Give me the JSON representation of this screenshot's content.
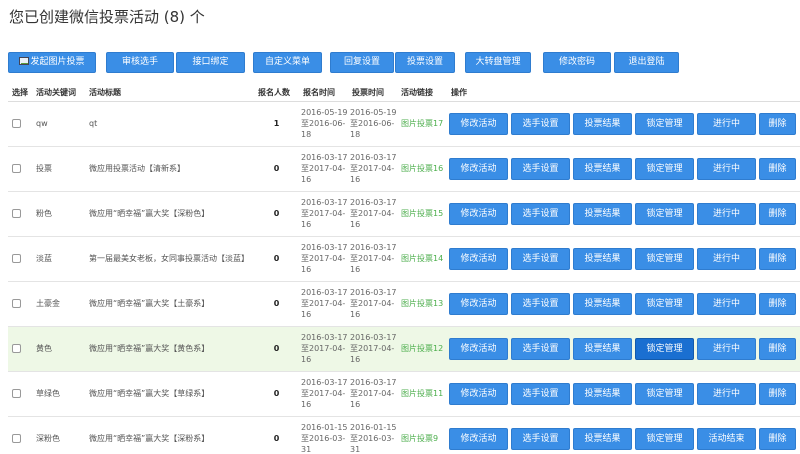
{
  "page": {
    "title": "您已创建微信投票活动 (8) 个"
  },
  "toolbar": {
    "buttons": [
      {
        "label": "发起图片投票",
        "icon": "picture-icon"
      },
      {
        "label": "审核选手"
      },
      {
        "label": "接口绑定"
      },
      {
        "label": "自定义菜单"
      },
      {
        "label": "回复设置"
      },
      {
        "label": "投票设置"
      },
      {
        "label": "大转盘管理"
      },
      {
        "label": "修改密码"
      },
      {
        "label": "退出登陆"
      }
    ]
  },
  "table": {
    "headers": [
      "选择",
      "活动关键词",
      "活动标题",
      "报名人数",
      "报名时间",
      "投票时间",
      "活动链接",
      "操作"
    ],
    "ops": {
      "edit": "修改活动",
      "contestants": "选手设置",
      "results": "投票结果",
      "lock": "锁定管理",
      "running": "进行中",
      "ended": "活动结束",
      "delete": "删除"
    },
    "rows": [
      {
        "keyword": "qw",
        "title": "qt",
        "count": "1",
        "signup": "2016-05-19至2016-06-18",
        "vote": "2016-05-19至2016-06-18",
        "link": "图片投票17",
        "status": "进行中"
      },
      {
        "keyword": "投票",
        "title": "微应用投票活动【清新系】",
        "count": "0",
        "signup": "2016-03-17至2017-04-16",
        "vote": "2016-03-17至2017-04-16",
        "link": "图片投票16",
        "status": "进行中"
      },
      {
        "keyword": "粉色",
        "title": "微应用“晒幸福”赢大奖【深粉色】",
        "count": "0",
        "signup": "2016-03-17至2017-04-16",
        "vote": "2016-03-17至2017-04-16",
        "link": "图片投票15",
        "status": "进行中"
      },
      {
        "keyword": "淡蓝",
        "title": "第一届最美女老板，女同事投票活动【淡蓝】",
        "count": "0",
        "signup": "2016-03-17至2017-04-16",
        "vote": "2016-03-17至2017-04-16",
        "link": "图片投票14",
        "status": "进行中"
      },
      {
        "keyword": "土豪金",
        "title": "微应用“晒幸福”赢大奖【土豪系】",
        "count": "0",
        "signup": "2016-03-17至2017-04-16",
        "vote": "2016-03-17至2017-04-16",
        "link": "图片投票13",
        "status": "进行中"
      },
      {
        "keyword": "黄色",
        "title": "微应用“晒幸福”赢大奖【黄色系】",
        "count": "0",
        "signup": "2016-03-17至2017-04-16",
        "vote": "2016-03-17至2017-04-16",
        "link": "图片投票12",
        "status": "进行中"
      },
      {
        "keyword": "草绿色",
        "title": "微应用“晒幸福”赢大奖【草绿系】",
        "count": "0",
        "signup": "2016-03-17至2017-04-16",
        "vote": "2016-03-17至2017-04-16",
        "link": "图片投票11",
        "status": "进行中"
      },
      {
        "keyword": "深粉色",
        "title": "微应用“晒幸福”赢大奖【深粉系】",
        "count": "0",
        "signup": "2016-01-15至2016-03-31",
        "vote": "2016-01-15至2016-03-31",
        "link": "图片投票9",
        "status": "活动结束"
      }
    ]
  },
  "colors": {
    "button": "#3a8ee6",
    "button_active": "#1a6fd1",
    "link": "#4cae4c",
    "row_highlight": "#eef8e6"
  }
}
